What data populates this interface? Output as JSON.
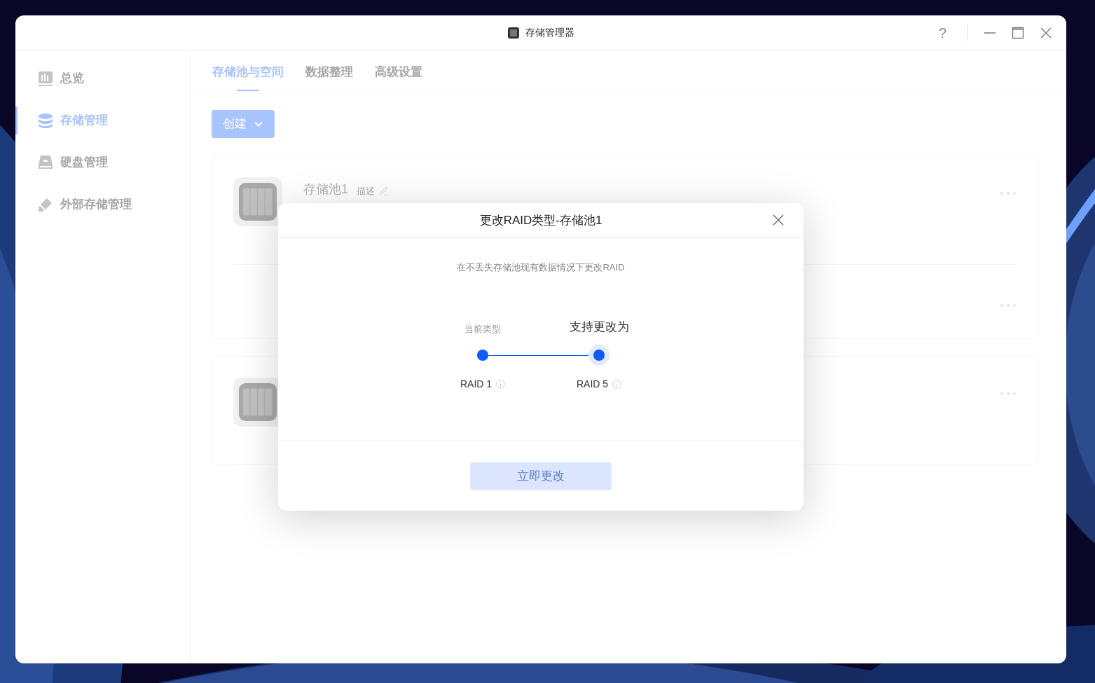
{
  "window": {
    "title": "存储管理器",
    "help": "?"
  },
  "sidebar": {
    "items": [
      {
        "kind": "overview",
        "label": "总览",
        "selected": false
      },
      {
        "kind": "storage",
        "label": "存储管理",
        "selected": true
      },
      {
        "kind": "disk",
        "label": "硬盘管理",
        "selected": false
      },
      {
        "kind": "external",
        "label": "外部存储管理",
        "selected": false
      }
    ]
  },
  "tabs": [
    {
      "label": "存储池与空间",
      "selected": true
    },
    {
      "label": "数据整理",
      "selected": false
    },
    {
      "label": "高级设置",
      "selected": false
    }
  ],
  "create_button": {
    "label": "创建"
  },
  "pools": [
    {
      "rows": [
        {
          "kind": "pool",
          "name": "存储池1",
          "description": "描述"
        },
        {
          "kind": "volume"
        }
      ]
    },
    {
      "rows": [
        {
          "kind": "pool"
        }
      ]
    }
  ],
  "dialog": {
    "title": "更改RAID类型-存储池1",
    "description": "在不丢失存储池现有数据情况下更改RAID",
    "current_label": "当前类型",
    "target_label": "支持更改为",
    "steps": [
      {
        "label": "RAID 1",
        "selected": false
      },
      {
        "label": "RAID 5",
        "selected": true
      }
    ],
    "confirm_button": {
      "label": "立即更改",
      "disabled": true
    }
  }
}
